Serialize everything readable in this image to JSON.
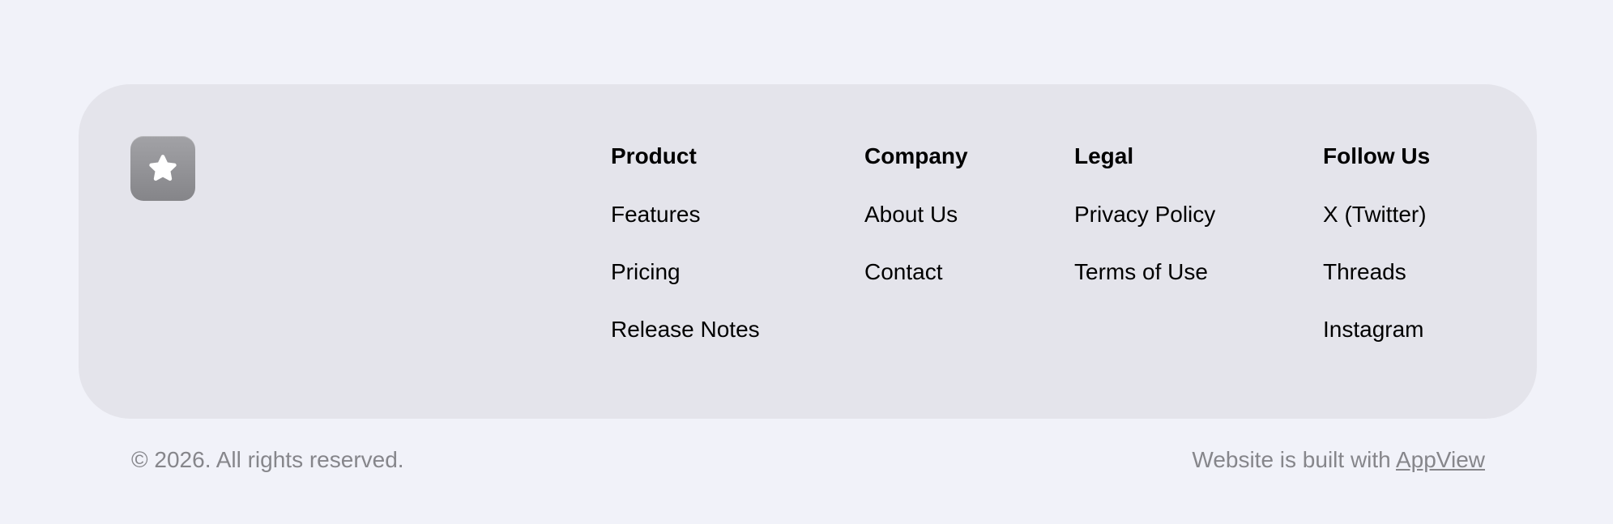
{
  "footer": {
    "logo_icon": "star-icon",
    "columns": [
      {
        "heading": "Product",
        "links": [
          "Features",
          "Pricing",
          "Release Notes"
        ]
      },
      {
        "heading": "Company",
        "links": [
          "About Us",
          "Contact"
        ]
      },
      {
        "heading": "Legal",
        "links": [
          "Privacy Policy",
          "Terms of Use"
        ]
      },
      {
        "heading": "Follow Us",
        "links": [
          "X (Twitter)",
          "Threads",
          "Instagram"
        ]
      }
    ]
  },
  "bottom": {
    "copyright": "© 2026. All rights reserved.",
    "credit_prefix": "Website is built with ",
    "credit_link": "AppView"
  },
  "colors": {
    "page_background": "#f1f2f9",
    "card_background": "#e4e4eb",
    "muted_text": "#86868b",
    "logo_gradient_top": "#a2a2a6",
    "logo_gradient_bottom": "#858589"
  }
}
